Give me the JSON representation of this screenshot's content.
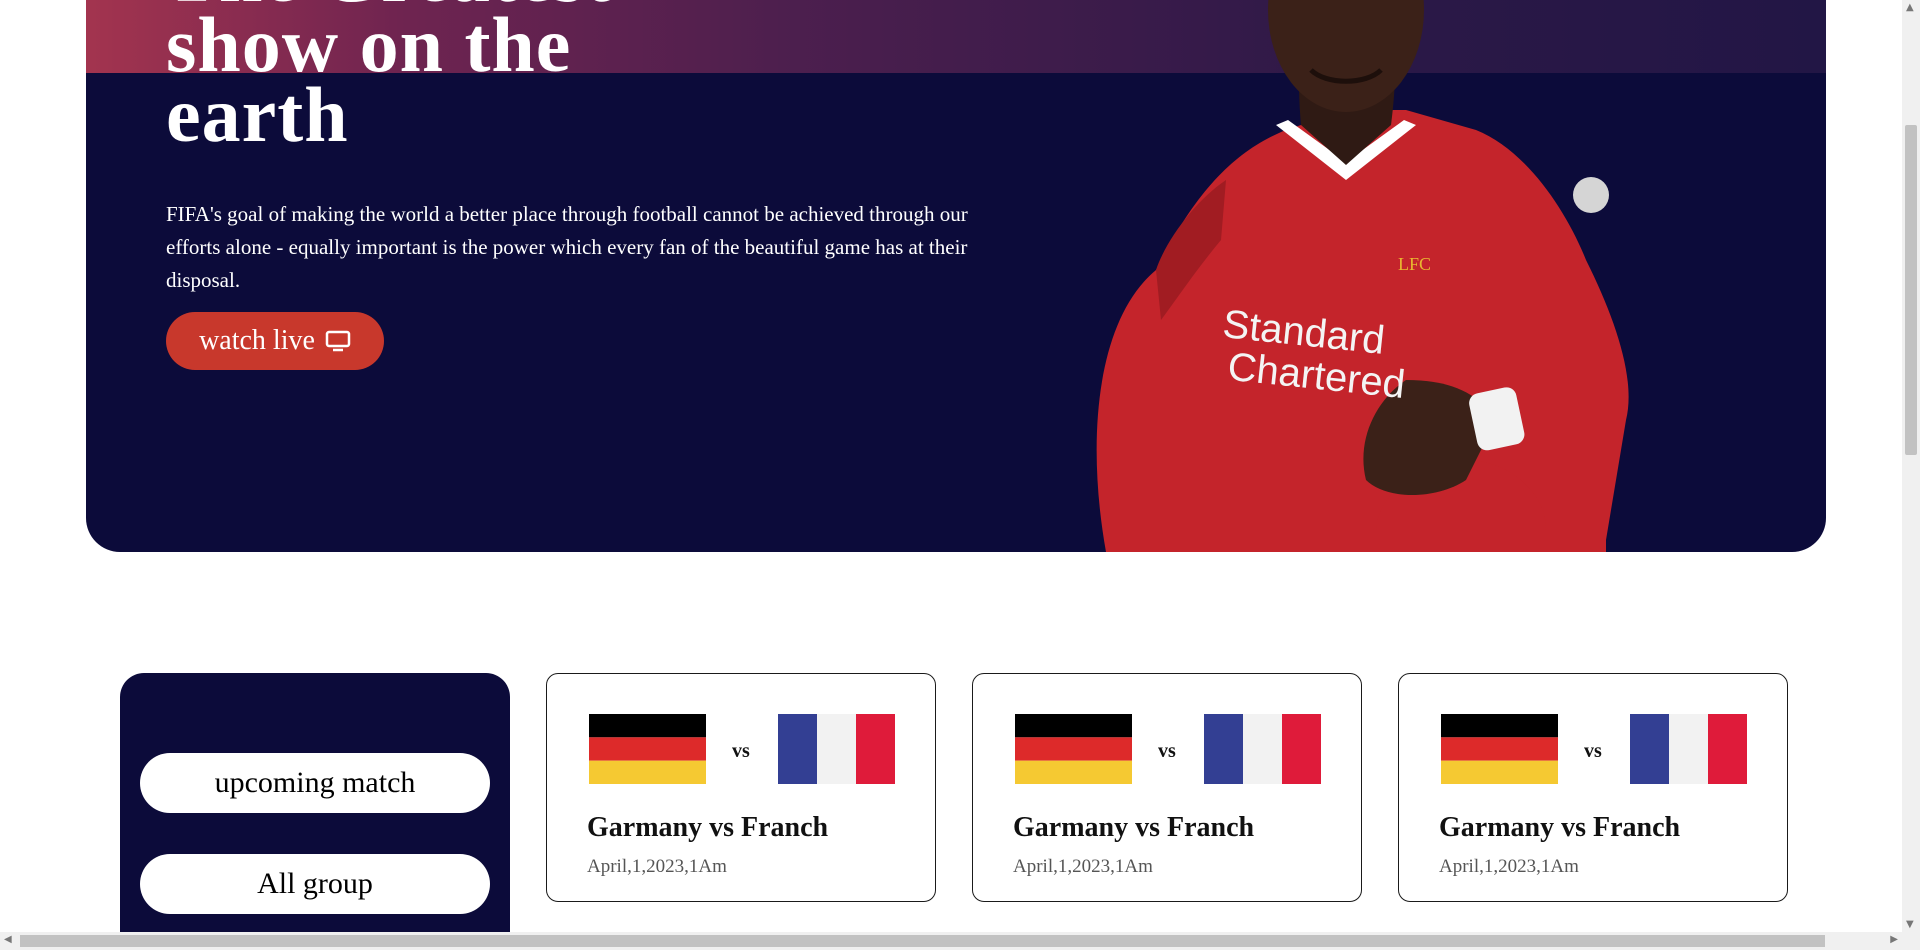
{
  "hero": {
    "title_line1": "The Greatest",
    "title_line2": "show on the",
    "title_line3": "earth",
    "description": "FIFA's goal of making the world a better place through football cannot be achieved through our efforts alone - equally important is the power which every fan of the beautiful game has at their disposal.",
    "watch_button_label": "watch live",
    "watch_button_icon": "tv-icon",
    "player_jersey_sponsor_line1": "Standard",
    "player_jersey_sponsor_line2": "Chartered",
    "player_jersey_crest": "LFC"
  },
  "sidebar": {
    "buttons": [
      {
        "label": "upcoming match"
      },
      {
        "label": "All group"
      }
    ]
  },
  "matches": [
    {
      "team1_flag": "germany-flag",
      "team2_flag": "france-flag",
      "vs": "vs",
      "title": "Garmany vs Franch",
      "date": "April,1,2023,1Am"
    },
    {
      "team1_flag": "germany-flag",
      "team2_flag": "france-flag",
      "vs": "vs",
      "title": "Garmany vs Franch",
      "date": "April,1,2023,1Am"
    },
    {
      "team1_flag": "germany-flag",
      "team2_flag": "france-flag",
      "vs": "vs",
      "title": "Garmany vs Franch",
      "date": "April,1,2023,1Am"
    }
  ],
  "colors": {
    "hero_bg": "#0c0b3a",
    "watch_button": "#c8382c",
    "germany": [
      "#000000",
      "#dd2a2a",
      "#f5c932"
    ],
    "france": [
      "#333f93",
      "#f2f2f2",
      "#df1b3a"
    ]
  }
}
